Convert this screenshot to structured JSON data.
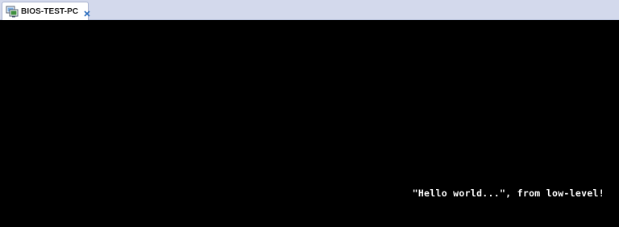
{
  "window": {
    "tab_title": "BIOS-TEST-PC",
    "tab_icon": "vm-icon",
    "close_icon": "close-icon",
    "accent": "#2e6fbf",
    "tabbar_bg": "#d3d9ec"
  },
  "console": {
    "background": "#000000",
    "text_color": "#ffffff",
    "output": "\"Hello world...\", from low-level!"
  }
}
